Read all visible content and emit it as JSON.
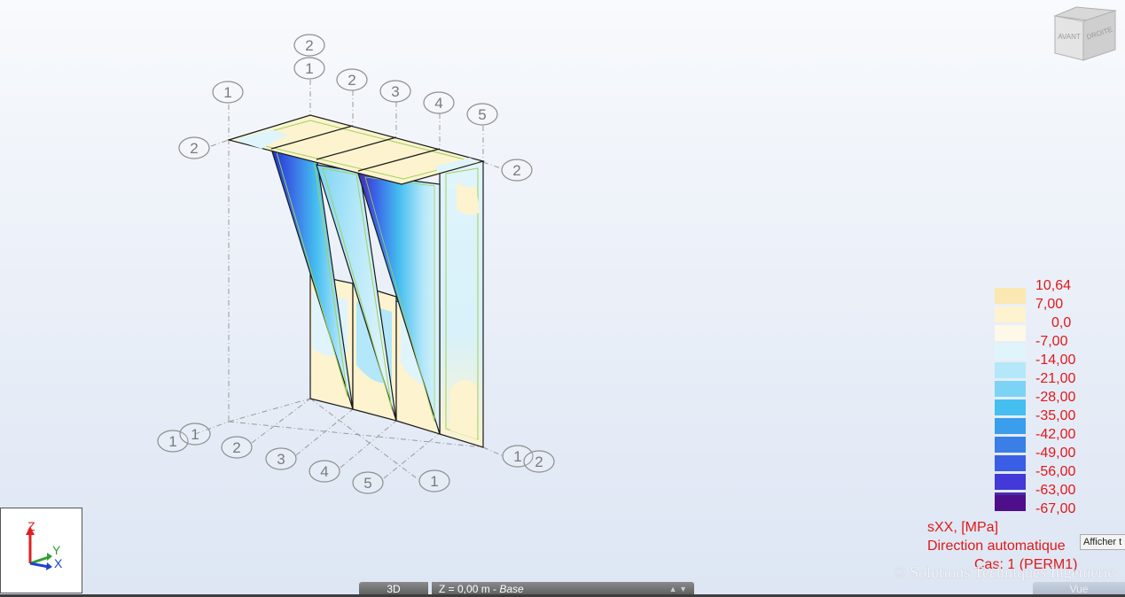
{
  "nav_cube": {
    "front_label": "AVANT",
    "right_label": "DROITE"
  },
  "grid_labels": {
    "top_row": [
      "2",
      "1",
      "1",
      "2",
      "3",
      "4",
      "5"
    ],
    "top_side": [
      "2",
      "2"
    ],
    "bottom_row": [
      "1",
      "1",
      "2",
      "3",
      "4",
      "5",
      "1"
    ],
    "bottom_side": [
      "1",
      "2"
    ]
  },
  "legend": {
    "entries": [
      {
        "label": "10,64",
        "color": "#fbe7b2"
      },
      {
        "label": "7,00",
        "color": "#fdf3cf"
      },
      {
        "label": "0,0",
        "color": "#fdf8e8"
      },
      {
        "label": "-7,00",
        "color": "#e0f4fb"
      },
      {
        "label": "-14,00",
        "color": "#b3e7f9"
      },
      {
        "label": "-21,00",
        "color": "#7dd3f5"
      },
      {
        "label": "-28,00",
        "color": "#45bef0"
      },
      {
        "label": "-35,00",
        "color": "#3a9eec"
      },
      {
        "label": "-42,00",
        "color": "#3a7ee8"
      },
      {
        "label": "-49,00",
        "color": "#3a5fe6"
      },
      {
        "label": "-56,00",
        "color": "#4338d8"
      },
      {
        "label": "-63,00",
        "color": "#4a2aaa"
      },
      {
        "label": "-67,00",
        "color": "#4f0f8a"
      }
    ]
  },
  "result_info": {
    "component": "sXX, [MPa]",
    "direction": "Direction automatique",
    "load_case": "Cas: 1 (PERM1)"
  },
  "tooltip": "Afficher t",
  "watermark": "© Solutions Techniques Ingenierie",
  "axes": {
    "z": "Z",
    "y": "Y",
    "x": "X"
  },
  "bottom_bar": {
    "view_button": "3D",
    "plane_value": "Z = 0,00 m - ",
    "plane_name": "Base",
    "arrows": "▲ ▼",
    "view_tab": "Vue"
  },
  "colors": {
    "legend_text": "#e01818",
    "outline": "#1a1a1a",
    "edge_highlight": "#9fd25a"
  }
}
